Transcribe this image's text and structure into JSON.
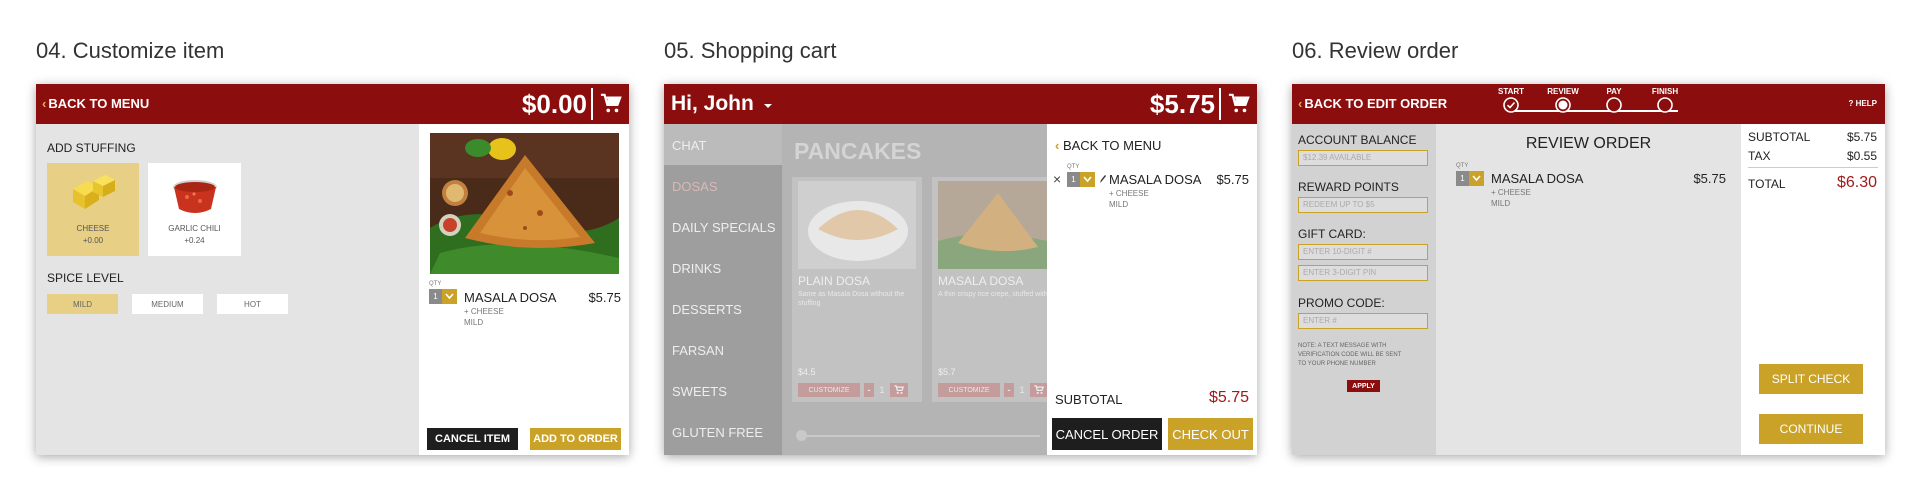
{
  "panels": {
    "customize": {
      "title": "04. Customize item"
    },
    "cart": {
      "title": "05. Shopping cart"
    },
    "review": {
      "title": "06. Review order"
    }
  },
  "customize": {
    "back_label": "BACK TO MENU",
    "total": "$0.00",
    "add_stuffing_label": "ADD STUFFING",
    "stuffing_options": [
      {
        "name": "CHEESE",
        "price": "+0.00",
        "selected": true
      },
      {
        "name": "GARLIC CHILI",
        "price": "+0.24",
        "selected": false
      }
    ],
    "spice_label": "SPICE LEVEL",
    "spice_options": [
      {
        "name": "MILD",
        "selected": true
      },
      {
        "name": "MEDIUM",
        "selected": false
      },
      {
        "name": "HOT",
        "selected": false
      }
    ],
    "item": {
      "qty_label": "QTY",
      "qty": "1",
      "name": "MASALA DOSA",
      "price": "$5.75",
      "mod1": "+ CHEESE",
      "mod2": "MILD"
    },
    "cancel_label": "CANCEL ITEM",
    "add_label": "ADD TO ORDER"
  },
  "cart": {
    "greeting": "Hi, John",
    "total": "$5.75",
    "categories": [
      "CHAT",
      "DOSAS",
      "DAILY SPECIALS",
      "DRINKS",
      "DESSERTS",
      "FARSAN",
      "SWEETS",
      "GLUTEN FREE"
    ],
    "active_category": "DOSAS",
    "section_title": "PANCAKES",
    "menu_items": [
      {
        "name": "PLAIN DOSA",
        "desc": "Same as Masala Dosa without the stuffing",
        "price": "$4.5",
        "customize": "CUSTOMIZE",
        "qty": "1"
      },
      {
        "name": "MASALA DOSA",
        "desc": "A thin crispy rice crepe, stuffed with spiced onions & potatoes, served with vegetable soup (sambar), & coconut chutney",
        "price": "$5.7",
        "customize": "CUSTOMIZE",
        "qty": "1"
      }
    ],
    "back_label": "BACK TO MENU",
    "item": {
      "qty_label": "QTY",
      "qty": "1",
      "name": "MASALA DOSA",
      "price": "$5.75",
      "mod1": "+ CHEESE",
      "mod2": "MILD"
    },
    "subtotal_label": "SUBTOTAL",
    "subtotal": "$5.75",
    "cancel_label": "CANCEL ORDER",
    "checkout_label": "CHECK OUT"
  },
  "review": {
    "back_label": "BACK TO EDIT ORDER",
    "steps": [
      "START",
      "REVIEW",
      "PAY",
      "FINISH"
    ],
    "current_step": "REVIEW",
    "help_label": "? HELP",
    "account_balance_label": "ACCOUNT BALANCE",
    "account_balance_value": "$12.39 AVAILABLE",
    "reward_label": "REWARD POINTS",
    "reward_value": "REDEEM UP TO $5",
    "gift_label": "GIFT CARD:",
    "gift_placeholder": "ENTER 10-DIGIT #",
    "pin_placeholder": "ENTER 3-DIGIT PIN",
    "promo_label": "PROMO CODE:",
    "promo_placeholder": "ENTER #",
    "note_line1": "NOTE: A TEXT MESSAGE WITH",
    "note_line2": "VERIFICATION CODE WILL BE SENT",
    "note_line3": "TO YOUR PHONE NUMBER",
    "apply_label": "APPLY",
    "review_title": "REVIEW ORDER",
    "item": {
      "qty_label": "QTY",
      "qty": "1",
      "name": "MASALA DOSA",
      "price": "$5.75",
      "mod1": "+ CHEESE",
      "mod2": "MILD"
    },
    "subtotal_label": "SUBTOTAL",
    "subtotal": "$5.75",
    "tax_label": "TAX",
    "tax": "$0.55",
    "total_label": "TOTAL",
    "total": "$6.30",
    "split_label": "SPLIT CHECK",
    "continue_label": "CONTINUE"
  },
  "colors": {
    "brand": "#8b0d0d",
    "accent": "#c9a227",
    "price_red": "#a11a1a"
  }
}
